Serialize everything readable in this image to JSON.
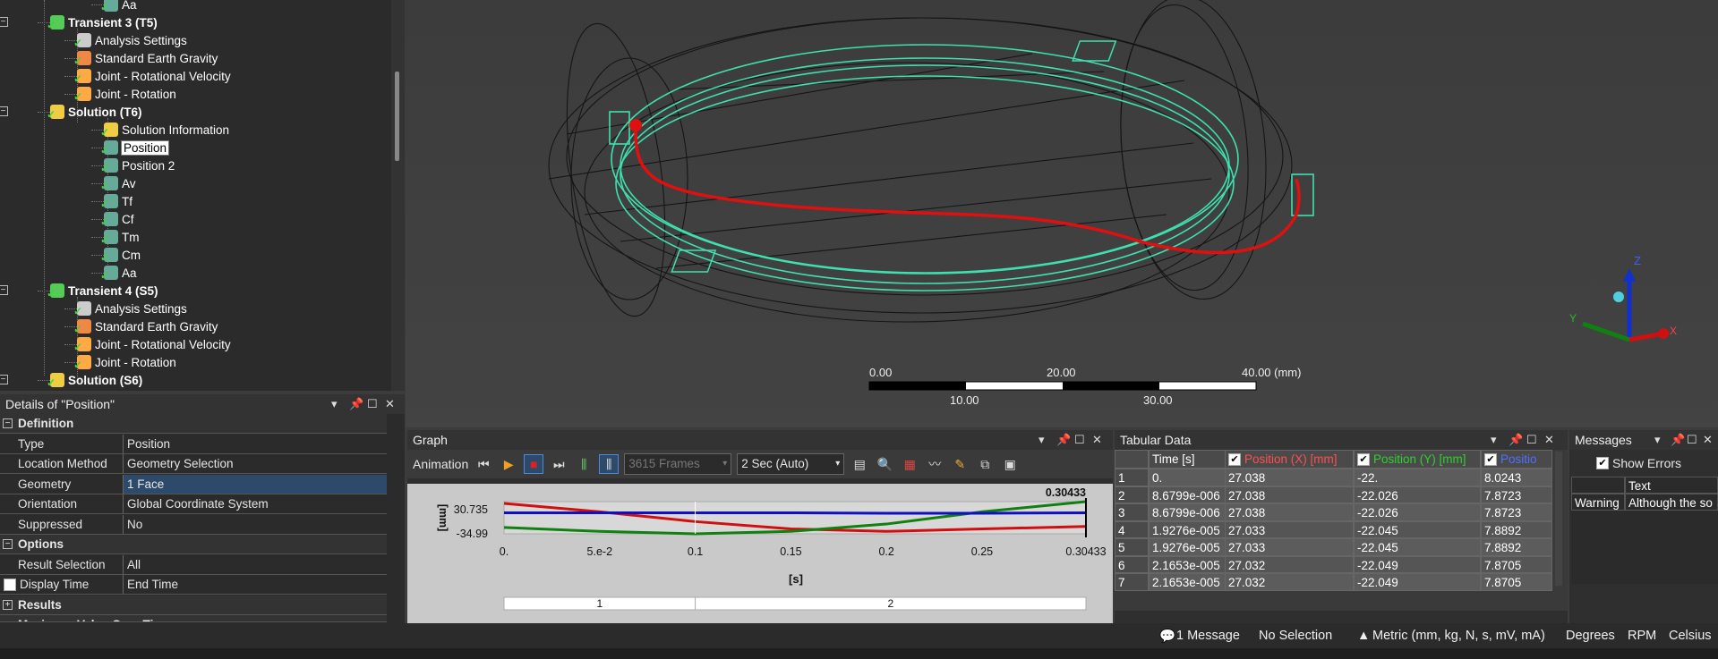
{
  "tree": {
    "rows": [
      {
        "label": "Aa",
        "bold": false,
        "icon": "result-icon"
      },
      {
        "label": "Transient 3 (T5)",
        "bold": true,
        "icon": "transient-icon"
      },
      {
        "label": "Analysis Settings",
        "bold": false,
        "icon": "settings-icon"
      },
      {
        "label": "Standard Earth Gravity",
        "bold": false,
        "icon": "gravity-icon"
      },
      {
        "label": "Joint - Rotational Velocity",
        "bold": false,
        "icon": "joint-icon"
      },
      {
        "label": "Joint - Rotation",
        "bold": false,
        "icon": "joint-icon"
      },
      {
        "label": "Solution (T6)",
        "bold": true,
        "icon": "solution-icon"
      },
      {
        "label": "Solution Information",
        "bold": false,
        "icon": "info-icon"
      },
      {
        "label": "Position",
        "bold": false,
        "icon": "result-icon",
        "selected": true
      },
      {
        "label": "Position 2",
        "bold": false,
        "icon": "result-icon"
      },
      {
        "label": "Av",
        "bold": false,
        "icon": "result-icon"
      },
      {
        "label": "Tf",
        "bold": false,
        "icon": "result-icon"
      },
      {
        "label": "Cf",
        "bold": false,
        "icon": "result-icon"
      },
      {
        "label": "Tm",
        "bold": false,
        "icon": "result-icon"
      },
      {
        "label": "Cm",
        "bold": false,
        "icon": "result-icon"
      },
      {
        "label": "Aa",
        "bold": false,
        "icon": "result-icon"
      },
      {
        "label": "Transient 4 (S5)",
        "bold": true,
        "icon": "transient-icon"
      },
      {
        "label": "Analysis Settings",
        "bold": false,
        "icon": "settings-icon"
      },
      {
        "label": "Standard Earth Gravity",
        "bold": false,
        "icon": "gravity-icon"
      },
      {
        "label": "Joint - Rotational Velocity",
        "bold": false,
        "icon": "joint-icon"
      },
      {
        "label": "Joint - Rotation",
        "bold": false,
        "icon": "joint-icon"
      },
      {
        "label": "Solution (S6)",
        "bold": true,
        "icon": "solution-icon"
      }
    ]
  },
  "details": {
    "title": "Details of \"Position\"",
    "definition": "Definition",
    "rows": [
      {
        "k": "Type",
        "v": "Position"
      },
      {
        "k": "Location Method",
        "v": "Geometry Selection"
      },
      {
        "k": "Geometry",
        "v": "1 Face"
      },
      {
        "k": "Orientation",
        "v": "Global Coordinate System"
      },
      {
        "k": "Suppressed",
        "v": "No"
      }
    ],
    "options": "Options",
    "rows2": [
      {
        "k": "Result Selection",
        "v": "All"
      },
      {
        "k": "Display Time",
        "v": "End Time"
      }
    ],
    "results": "Results",
    "cutoff": "Maximum Value Over Time"
  },
  "viewport": {
    "scale_ticks_top": [
      "0.00",
      "20.00",
      "40.00 (mm)"
    ],
    "scale_ticks_bottom": [
      "10.00",
      "30.00"
    ],
    "axes": {
      "z": "Z",
      "y": "Y",
      "x": "X"
    }
  },
  "graph": {
    "title": "Graph",
    "animation_label": "Animation",
    "frames": "3615 Frames",
    "duration": "2 Sec (Auto)",
    "ymax": "30.735",
    "ymin": "-34.99",
    "yunit": "[mm]",
    "current_time": "0.30433",
    "xticks": [
      "0.",
      "5.e-2",
      "0.1",
      "0.15",
      "0.2",
      "0.25",
      "0.30433"
    ],
    "xunit": "[s]",
    "steps": [
      "1",
      "2"
    ]
  },
  "chart_data": {
    "type": "line",
    "xlabel": "[s]",
    "ylabel": "[mm]",
    "xlim": [
      0,
      0.30433
    ],
    "ylim": [
      -34.99,
      30.735
    ],
    "series": [
      {
        "name": "Position (X) [mm]",
        "color": "#d01010",
        "x": [
          0,
          0.05,
          0.1,
          0.15,
          0.2,
          0.25,
          0.30433
        ],
        "values": [
          27.038,
          10,
          -10,
          -25,
          -30,
          -25,
          -20
        ]
      },
      {
        "name": "Position (Y) [mm]",
        "color": "#108010",
        "x": [
          0,
          0.05,
          0.1,
          0.15,
          0.2,
          0.25,
          0.30433
        ],
        "values": [
          -22,
          -30,
          -34.99,
          -30,
          -15,
          10,
          30.735
        ]
      },
      {
        "name": "Position (Z) [mm]",
        "color": "#1010c0",
        "x": [
          0,
          0.05,
          0.1,
          0.15,
          0.2,
          0.25,
          0.30433
        ],
        "values": [
          8.0243,
          8,
          8,
          8,
          7,
          7,
          8
        ]
      }
    ]
  },
  "tabular": {
    "title": "Tabular Data",
    "headers": [
      "Time [s]",
      "Position (X) [mm]",
      "Position (Y) [mm]",
      "Positio"
    ],
    "rows": [
      [
        "1",
        "0.",
        "27.038",
        "-22.",
        "8.0243"
      ],
      [
        "2",
        "8.6799e-006",
        "27.038",
        "-22.026",
        "7.8723"
      ],
      [
        "3",
        "8.6799e-006",
        "27.038",
        "-22.026",
        "7.8723"
      ],
      [
        "4",
        "1.9276e-005",
        "27.033",
        "-22.045",
        "7.8892"
      ],
      [
        "5",
        "1.9276e-005",
        "27.033",
        "-22.045",
        "7.8892"
      ],
      [
        "6",
        "2.1653e-005",
        "27.032",
        "-22.049",
        "7.8705"
      ],
      [
        "7",
        "2.1653e-005",
        "27.032",
        "-22.049",
        "7.8705"
      ]
    ]
  },
  "messages": {
    "title": "Messages",
    "show_errors": "Show Errors",
    "col_text": "Text",
    "row_type": "Warning",
    "row_text": "Although the so"
  },
  "status": {
    "messages": "1 Message",
    "selection": "No Selection",
    "units": "Metric (mm, kg, N, s, mV, mA)",
    "angle": "Degrees",
    "speed": "RPM",
    "temp": "Celsius"
  },
  "colors": {
    "accent": "#2d4a6a",
    "x": "#d01010",
    "y": "#108010",
    "z": "#1010c0",
    "model": "#3fe0b0"
  }
}
